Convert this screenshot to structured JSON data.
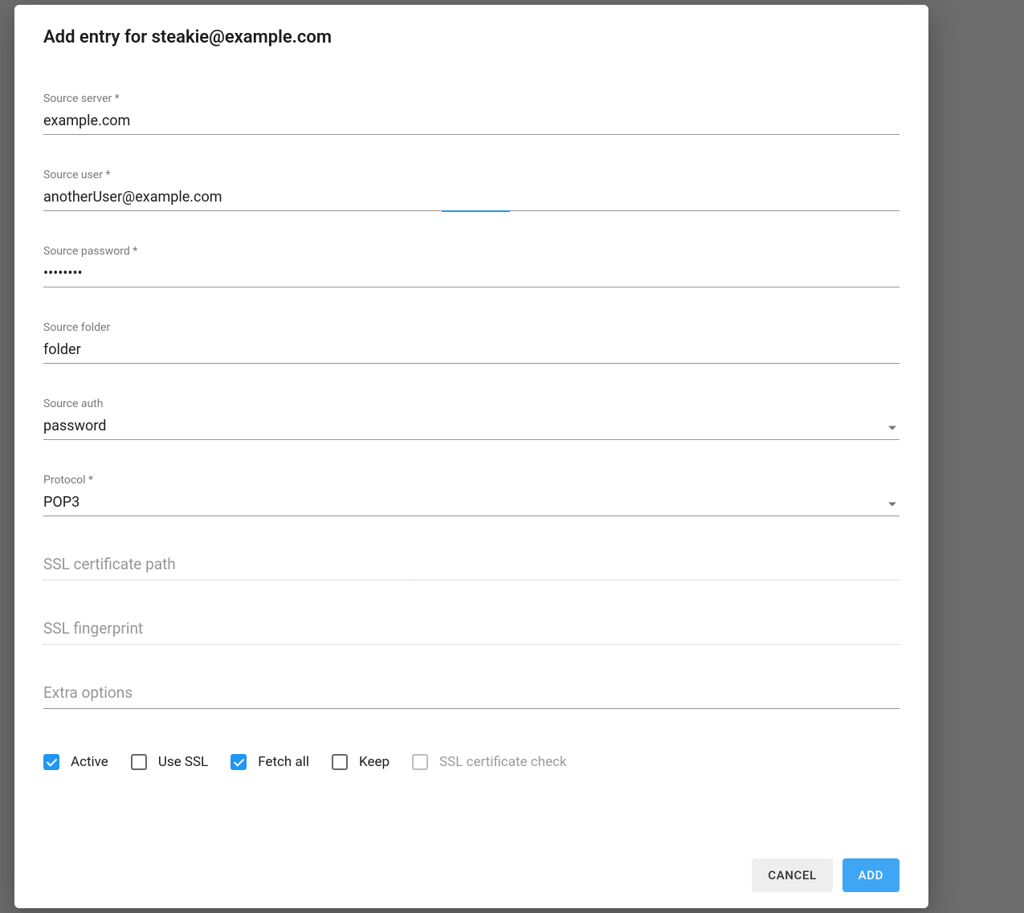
{
  "dialog": {
    "title": "Add entry for steakie@example.com"
  },
  "fields": {
    "source_server": {
      "label": "Source server *",
      "value": "example.com"
    },
    "source_user": {
      "label": "Source user *",
      "value": "anotherUser@example.com"
    },
    "source_password": {
      "label": "Source password *",
      "value": "••••••••"
    },
    "source_folder": {
      "label": "Source folder",
      "value": "folder"
    },
    "source_auth": {
      "label": "Source auth",
      "value": "password"
    },
    "protocol": {
      "label": "Protocol *",
      "value": "POP3"
    },
    "ssl_cert_path": {
      "placeholder": "SSL certificate path",
      "value": ""
    },
    "ssl_fingerprint": {
      "placeholder": "SSL fingerprint",
      "value": ""
    },
    "extra_options": {
      "placeholder": "Extra options",
      "value": ""
    }
  },
  "checkboxes": {
    "active": {
      "label": "Active",
      "checked": true,
      "disabled": false
    },
    "use_ssl": {
      "label": "Use SSL",
      "checked": false,
      "disabled": false
    },
    "fetch_all": {
      "label": "Fetch all",
      "checked": true,
      "disabled": false
    },
    "keep": {
      "label": "Keep",
      "checked": false,
      "disabled": false
    },
    "ssl_check": {
      "label": "SSL certificate check",
      "checked": false,
      "disabled": true
    }
  },
  "actions": {
    "cancel": "CANCEL",
    "add": "ADD"
  }
}
